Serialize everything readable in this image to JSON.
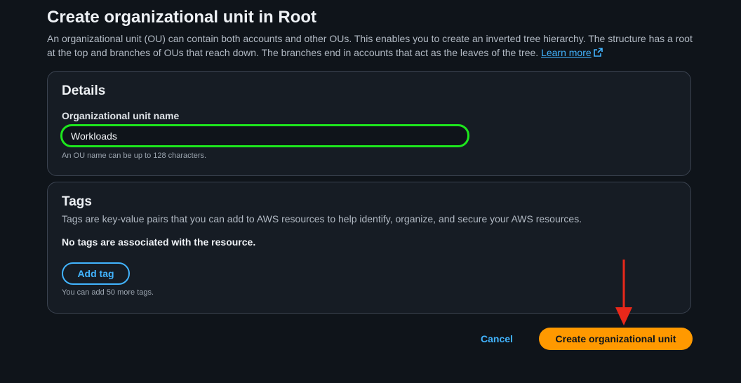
{
  "page": {
    "title": "Create organizational unit in Root",
    "description": "An organizational unit (OU) can contain both accounts and other OUs. This enables you to create an inverted tree hierarchy. The structure has a root at the top and branches of OUs that reach down. The branches end in accounts that act as the leaves of the tree.",
    "learn_more": "Learn more",
    "learn_more_icon": "external-link-icon"
  },
  "details": {
    "heading": "Details",
    "field_label": "Organizational unit name",
    "field_value": "Workloads",
    "field_hint": "An OU name can be up to 128 characters."
  },
  "tags": {
    "heading": "Tags",
    "description": "Tags are key-value pairs that you can add to AWS resources to help identify, organize, and secure your AWS resources.",
    "empty_message": "No tags are associated with the resource.",
    "add_button": "Add tag",
    "hint": "You can add 50 more tags."
  },
  "actions": {
    "cancel": "Cancel",
    "submit": "Create organizational unit"
  },
  "colors": {
    "background": "#0f141a",
    "panel": "#161c24",
    "link": "#42b4ff",
    "primary": "#ff9900",
    "focus_highlight": "#1de61d",
    "annotation_arrow": "#e8281a"
  },
  "annotations": {
    "arrow_icon": "red-arrow-down-icon"
  }
}
